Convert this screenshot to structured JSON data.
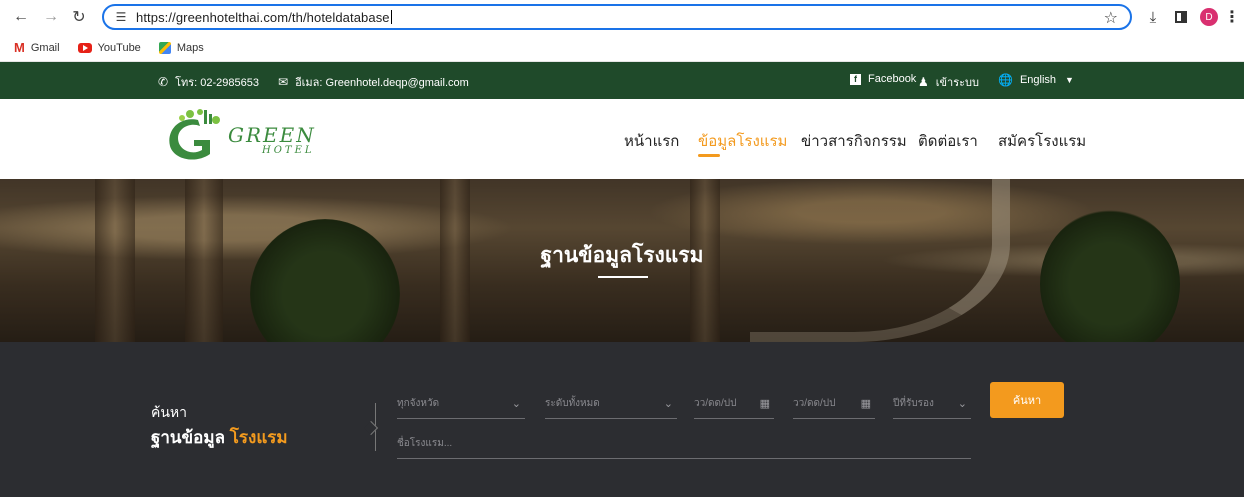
{
  "browser": {
    "url": "https://greenhotelthai.com/th/hoteldatabase",
    "profile_initial": "D",
    "bookmarks": [
      {
        "label": "Gmail",
        "icon": "gmail-icon"
      },
      {
        "label": "YouTube",
        "icon": "youtube-icon"
      },
      {
        "label": "Maps",
        "icon": "maps-icon"
      }
    ]
  },
  "topbar": {
    "phone": "โทร: 02-2985653",
    "email": "อีเมล: Greenhotel.deqp@gmail.com",
    "facebook": "Facebook",
    "login": "เข้าระบบ",
    "language": "English"
  },
  "header": {
    "logo_text": "GREEN",
    "logo_sub": "HOTEL",
    "menu": [
      {
        "label": "หน้าแรก",
        "active": false
      },
      {
        "label": "ข้อมูลโรงแรม",
        "active": true
      },
      {
        "label": "ข่าวสารกิจกรรม",
        "active": false
      },
      {
        "label": "ติดต่อเรา",
        "active": false
      },
      {
        "label": "สมัครโรงแรม",
        "active": false
      }
    ]
  },
  "hero": {
    "title": "ฐานข้อมูลโรงแรม"
  },
  "search": {
    "label_small": "ค้นหา",
    "label_big": "ฐานข้อมูล",
    "label_highlight": "โรงแรม",
    "province": "ทุกจังหวัด",
    "level": "ระดับทั้งหมด",
    "date_from": "วว/ดด/ปป",
    "date_to": "วว/ดด/ปป",
    "year": "ปีที่รับรอง",
    "hotel_name_placeholder": "ชื่อโรงแรม...",
    "button": "ค้นหา"
  },
  "colors": {
    "topbar": "#1f4a2a",
    "accent": "#f39a1e",
    "search_bg": "#2c2d31",
    "logo_green": "#3b8b3e"
  }
}
